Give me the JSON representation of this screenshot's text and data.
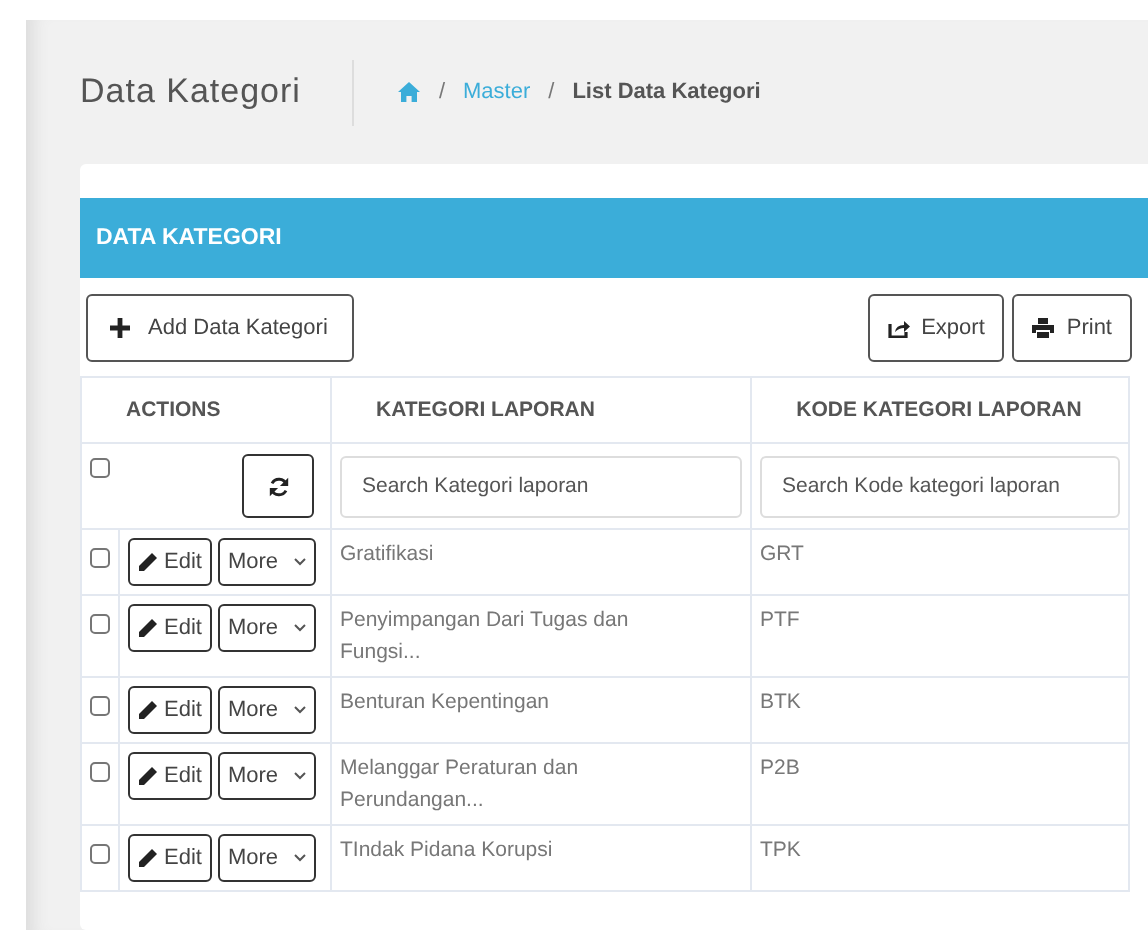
{
  "page_title": "Data Kategori",
  "breadcrumb": [
    {
      "separator": "/",
      "label": "Master",
      "link": true
    },
    {
      "separator": "/",
      "label": "List Data Kategori",
      "link": false
    }
  ],
  "panel": {
    "title": "DATA KATEGORI"
  },
  "toolbar": {
    "add_button": "Add Data Kategori",
    "export_button": "Export",
    "print_button": "Print"
  },
  "table": {
    "columns": [
      "ACTIONS",
      "KATEGORI LAPORAN",
      "KODE KATEGORI LAPORAN"
    ],
    "select_all_checked": false,
    "filters": [
      {
        "placeholder": "Search Kategori laporan"
      },
      {
        "placeholder": "Search Kode kategori laporan"
      }
    ],
    "rows": [
      {
        "checked": false,
        "edit": "Edit",
        "more": "More",
        "kategori": "Gratifikasi",
        "kode": "GRT"
      },
      {
        "checked": false,
        "edit": "Edit",
        "more": "More",
        "kategori": "Penyimpangan Dari Tugas dan Fungsi...",
        "kode": "PTF"
      },
      {
        "checked": false,
        "edit": "Edit",
        "more": "More",
        "kategori": "Benturan Kepentingan",
        "kode": "BTK"
      },
      {
        "checked": false,
        "edit": "Edit",
        "more": "More",
        "kategori": "Melanggar Peraturan dan Perundangan...",
        "kode": "P2B"
      },
      {
        "checked": false,
        "edit": "Edit",
        "more": "More",
        "kategori": "TIndak Pidana Korupsi",
        "kode": "TPK"
      }
    ]
  }
}
